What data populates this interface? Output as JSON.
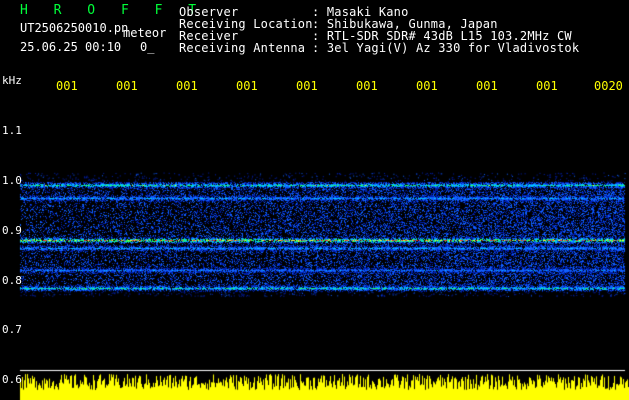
{
  "app": {
    "title": "H R O F F T"
  },
  "file": {
    "name": "UT2506250010.pn",
    "type": "meteor",
    "date_time": "25.06.25 00:10",
    "status": "0_"
  },
  "info": {
    "labels": [
      "Observer",
      "Receiving Location",
      "Receiver",
      "Receiving Antenna"
    ],
    "values": [
      ": Masaki Kano",
      ": Shibukawa, Gunma, Japan",
      ": RTL-SDR SDR# 43dB L15 103.2MHz CW",
      ": 3el Yagi(V) Az 330 for Vladivostok"
    ]
  },
  "axes": {
    "y_unit": "kHz",
    "y_ticks": [
      "1.1",
      "1.0",
      "0.9",
      "0.8",
      "0.7",
      "0.6"
    ],
    "x_ticks": [
      "001",
      "001",
      "001",
      "001",
      "001",
      "001",
      "001",
      "001",
      "001",
      "0020"
    ]
  },
  "colors": {
    "background": "#000000",
    "header_text": "#ffffff",
    "title": "#00ff3a",
    "tick_x": "#ffff00",
    "signal_low": "#0000aa",
    "signal_high": "#ff2020",
    "level_bar": "#ffff00"
  },
  "spectrogram": {
    "freq_range_khz": [
      0.6,
      1.15
    ],
    "bands_khz": [
      {
        "f": 0.99,
        "intensity": 0.75
      },
      {
        "f": 0.965,
        "intensity": 0.55
      },
      {
        "f": 0.88,
        "intensity": 1.0
      },
      {
        "f": 0.865,
        "intensity": 0.55
      },
      {
        "f": 0.82,
        "intensity": 0.45
      },
      {
        "f": 0.785,
        "intensity": 0.7
      }
    ],
    "noise_region_khz": [
      0.78,
      0.995
    ]
  }
}
